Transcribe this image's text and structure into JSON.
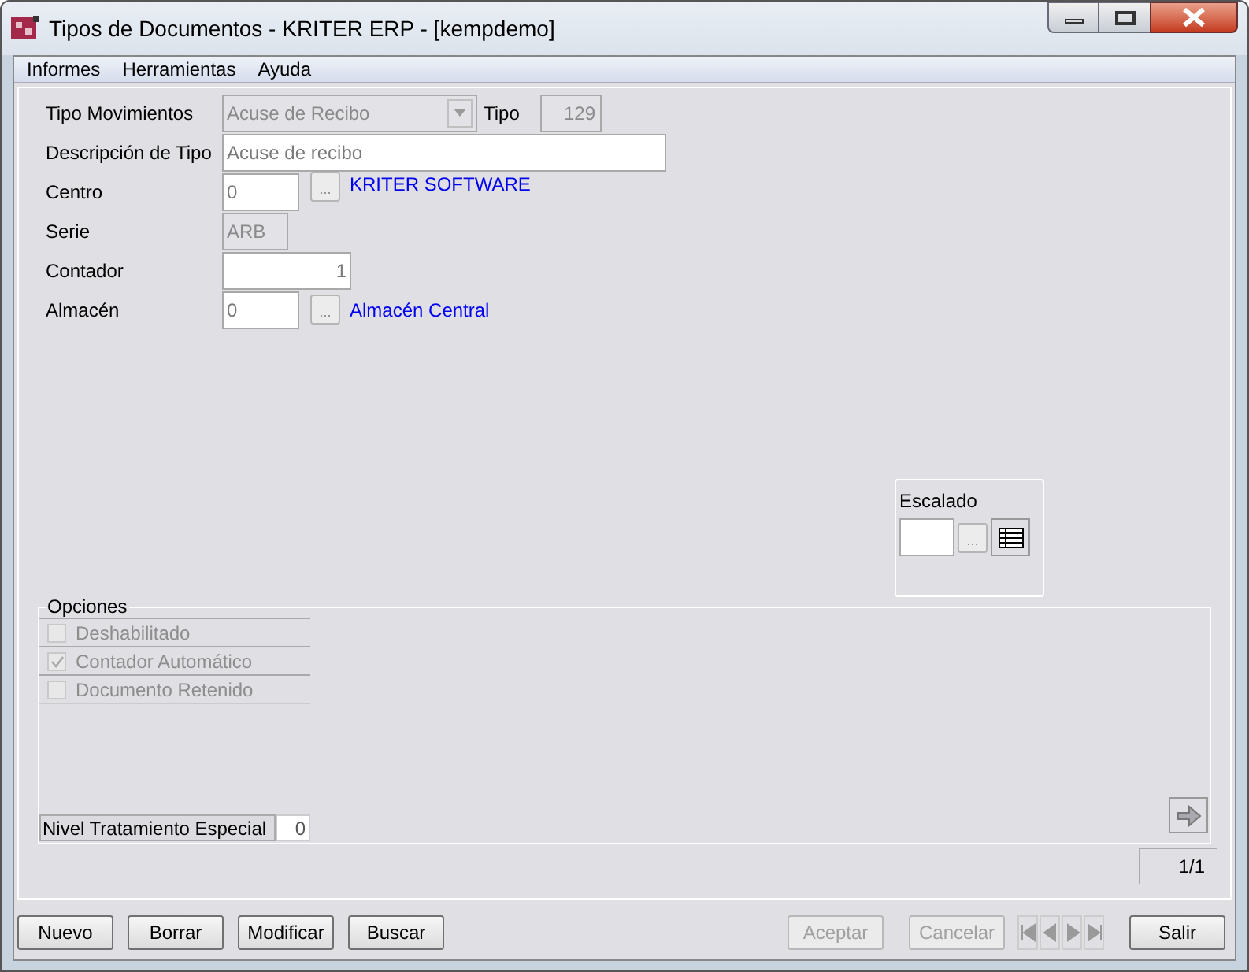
{
  "window": {
    "title": "Tipos de Documentos - KRITER ERP - [kempdemo]"
  },
  "menu": [
    "Informes",
    "Herramientas",
    "Ayuda"
  ],
  "form": [
    {
      "label": "Tipo Movimientos",
      "kind": "combo",
      "value": "Acuse de Recibo",
      "disabled": true,
      "extra_label": "Tipo",
      "extra_value": "129"
    },
    {
      "label": "Descripción de Tipo",
      "kind": "text",
      "value": "Acuse de recibo",
      "disabled": false
    },
    {
      "label": "Centro",
      "kind": "lookup",
      "value": "0",
      "disabled": false,
      "browse": "...",
      "link": "KRITER SOFTWARE"
    },
    {
      "label": "Serie",
      "kind": "short",
      "value": "ARB",
      "disabled": true
    },
    {
      "label": "Contador",
      "kind": "number",
      "value": "1",
      "disabled": false
    },
    {
      "label": "Almacén",
      "kind": "lookup",
      "value": "0",
      "disabled": false,
      "browse": "...",
      "link": "Almacén Central"
    }
  ],
  "escalado": {
    "label": "Escalado",
    "browse": "..."
  },
  "opciones": {
    "title": "Opciones",
    "items": [
      {
        "label": "Deshabilitado",
        "checked": false,
        "disabled": true
      },
      {
        "label": "Contador Automático",
        "checked": true,
        "disabled": true
      },
      {
        "label": "Documento Retenido",
        "checked": false,
        "disabled": true
      }
    ],
    "nivel_label": "Nivel Tratamiento Especial",
    "nivel_value": "0"
  },
  "record_counter": "1/1",
  "buttons_left": [
    {
      "label": "Nuevo",
      "disabled": false
    },
    {
      "label": "Borrar",
      "disabled": false
    },
    {
      "label": "Modificar",
      "disabled": false
    },
    {
      "label": "Buscar",
      "disabled": false
    }
  ],
  "buttons_right": [
    {
      "label": "Aceptar",
      "disabled": true
    },
    {
      "label": "Cancelar",
      "disabled": true
    }
  ],
  "exit_button": {
    "label": "Salir",
    "disabled": false
  }
}
